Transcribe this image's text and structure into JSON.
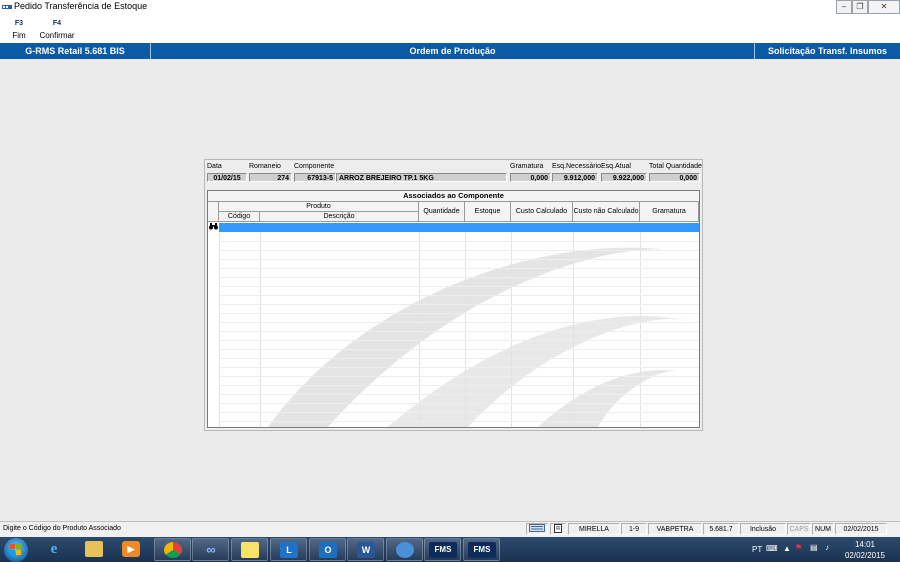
{
  "window": {
    "title": "Pedido Transferência de Estoque",
    "controls": [
      "minimize",
      "maximize",
      "close"
    ]
  },
  "toolbar": [
    {
      "key": "F3",
      "label": "Fim"
    },
    {
      "key": "F4",
      "label": "Confirmar"
    }
  ],
  "header": {
    "left": "G-RMS Retail 5.681 BIS",
    "center": "Ordem de Produção",
    "right": "Solicitação Transf. Insumos"
  },
  "form": {
    "labels": {
      "data": "Data",
      "romaneio": "Romaneio",
      "componente": "Componente",
      "gramatura": "Gramatura",
      "esq_necessario": "Esq.Necessário",
      "esq_atual": "Esq.Atual",
      "total_quantidade": "Total Quantidade"
    },
    "values": {
      "data": "01/02/15",
      "romaneio": "274",
      "componente_codigo": "67913-5",
      "componente_descricao": "ARROZ BREJEIRO TP.1 5KG",
      "gramatura": "0,000",
      "esq_necessario": "9.912,000",
      "esq_atual": "9.922,000",
      "total_quantidade": "0,000"
    }
  },
  "grid": {
    "title": "Associados ao Componente",
    "group_header": "Produto",
    "columns": {
      "codigo": "Código",
      "descricao": "Descrição",
      "quantidade": "Quantidade",
      "estoque": "Estoque",
      "custo_calculado": "Custo Calculado",
      "custo_nao_calculado": "Custo não Calculado",
      "gramatura": "Gramatura"
    },
    "rows": []
  },
  "statusbar": {
    "message": "Digite o Código do Produto Associado",
    "user": "MIRELLA",
    "range": "1-9",
    "station": "VABPETRA",
    "version": "5.681.7",
    "mode": "Inclusão",
    "caps": "CAPS",
    "num": "NUM",
    "date": "02/02/2015"
  },
  "taskbar": {
    "apps": [
      "windows-start",
      "internet-explorer",
      "file-explorer",
      "media-player",
      "chrome",
      "app-infinity",
      "sticky-notes",
      "lync",
      "outlook",
      "word",
      "network-app",
      "FMS",
      "FMS"
    ],
    "tray_lang": "PT",
    "time": "14:01",
    "date": "02/02/2015"
  }
}
